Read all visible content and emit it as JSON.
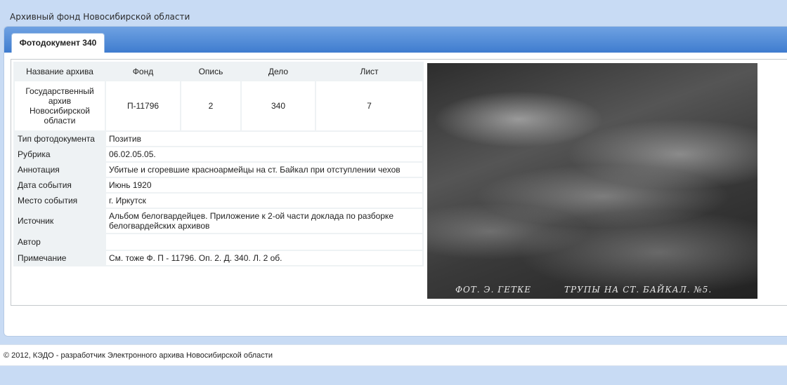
{
  "header": {
    "site_title": "Архивный фонд Новосибирской области"
  },
  "tabs": [
    {
      "label": "Фотодокумент 340",
      "active": true
    }
  ],
  "record": {
    "columns": [
      "Название архива",
      "Фонд",
      "Опись",
      "Дело",
      "Лист"
    ],
    "archive_name": "Государственный архив Новосибирской области",
    "fond": "П-11796",
    "opis": "2",
    "delo": "340",
    "list": "7",
    "fields": [
      {
        "label": "Тип фотодокумента",
        "value": "Позитив"
      },
      {
        "label": "Рубрика",
        "value": "06.02.05.05."
      },
      {
        "label": "Аннотация",
        "value": "Убитые и сгоревшие красноармейцы на ст. Байкал при отступлении чехов"
      },
      {
        "label": "Дата события",
        "value": "Июнь 1920"
      },
      {
        "label": "Место события",
        "value": "г. Иркутск"
      },
      {
        "label": "Источник",
        "value": "Альбом белогвардейцев. Приложение к 2-ой части доклада по разборке белогвардейских архивов"
      },
      {
        "label": "Автор",
        "value": ""
      },
      {
        "label": "Примечание",
        "value": "См. тоже Ф. П - 11796. Оп. 2. Д. 340. Л. 2 об."
      }
    ]
  },
  "photo": {
    "caption_left": "ФОТ. Э. ГЕТКЕ",
    "caption_right": "ТРУПЫ НА СТ. БАЙКАЛ. №5."
  },
  "footer": {
    "text": "© 2012, КЭДО - разработчик Электронного архива Новосибирской области"
  },
  "colors": {
    "page_bg": "#c8dbf4",
    "tabbar_top": "#6fa2e2",
    "tabbar_bottom": "#3f7ccf",
    "label_bg": "#eef2f4"
  }
}
